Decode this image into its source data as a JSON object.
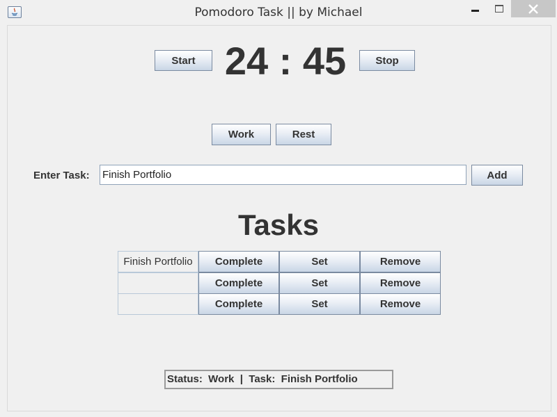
{
  "window": {
    "title": "Pomodoro Task || by Michael"
  },
  "timer": {
    "display": "24 : 45",
    "start_label": "Start",
    "stop_label": "Stop"
  },
  "mode": {
    "work_label": "Work",
    "rest_label": "Rest"
  },
  "task_entry": {
    "label": "Enter Task:",
    "value": "Finish Portfolio",
    "add_label": "Add"
  },
  "tasks": {
    "heading": "Tasks",
    "rows": [
      {
        "name": "Finish Portfolio",
        "complete": "Complete",
        "set": "Set",
        "remove": "Remove"
      },
      {
        "name": "",
        "complete": "Complete",
        "set": "Set",
        "remove": "Remove"
      },
      {
        "name": "",
        "complete": "Complete",
        "set": "Set",
        "remove": "Remove"
      }
    ]
  },
  "status": {
    "text": "Status:  Work  |  Task:  Finish Portfolio"
  },
  "colors": {
    "background": "#f0f0f0",
    "button_border": "#7a8aa0",
    "text": "#333333",
    "close_button": "#c7c7c7"
  }
}
